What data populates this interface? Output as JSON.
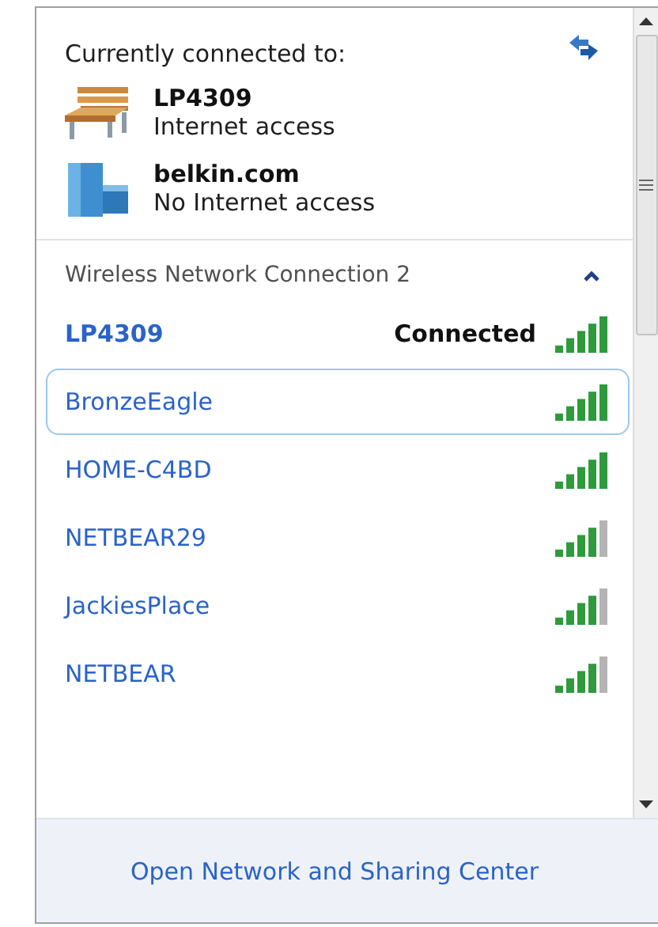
{
  "header": {
    "title": "Currently connected to:"
  },
  "connections": [
    {
      "kind": "bench",
      "name": "LP4309",
      "access": "Internet access"
    },
    {
      "kind": "building",
      "name": "belkin.com",
      "access": "No Internet access"
    }
  ],
  "section": {
    "title": "Wireless Network Connection 2",
    "expanded": true
  },
  "networks": [
    {
      "name": "LP4309",
      "status": "Connected",
      "connected": true,
      "selected": false,
      "level": 1
    },
    {
      "name": "BronzeEagle",
      "connected": false,
      "selected": true,
      "level": 1
    },
    {
      "name": "HOME-C4BD",
      "connected": false,
      "selected": false,
      "level": 1
    },
    {
      "name": "NETBEAR29",
      "connected": false,
      "selected": false,
      "level": 0.8
    },
    {
      "name": "JackiesPlace",
      "connected": false,
      "selected": false,
      "level": 0.8
    },
    {
      "name": "NETBEAR",
      "connected": false,
      "selected": false,
      "level": 0.8
    }
  ],
  "footer": {
    "link": "Open Network and Sharing Center"
  }
}
